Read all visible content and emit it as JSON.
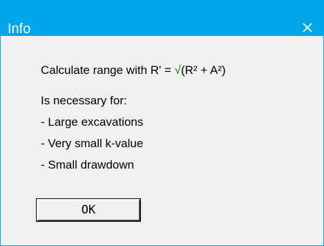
{
  "window": {
    "title": "Info",
    "close_glyph": "✕"
  },
  "message": {
    "formula_prefix": "Calculate range with R' = ",
    "sqrt_glyph": "√",
    "formula_suffix": "(R² + A²)",
    "intro": "Is necessary for:",
    "items": [
      " - Large excavations",
      " - Very small k-value",
      " - Small drawdown"
    ]
  },
  "buttons": {
    "ok_label": "OK"
  },
  "colors": {
    "titlebar": "#00a6e8",
    "sqrt_sign": "#008000",
    "dialog_background": "#f0f0f0"
  },
  "icons": {
    "close": "close-icon"
  }
}
